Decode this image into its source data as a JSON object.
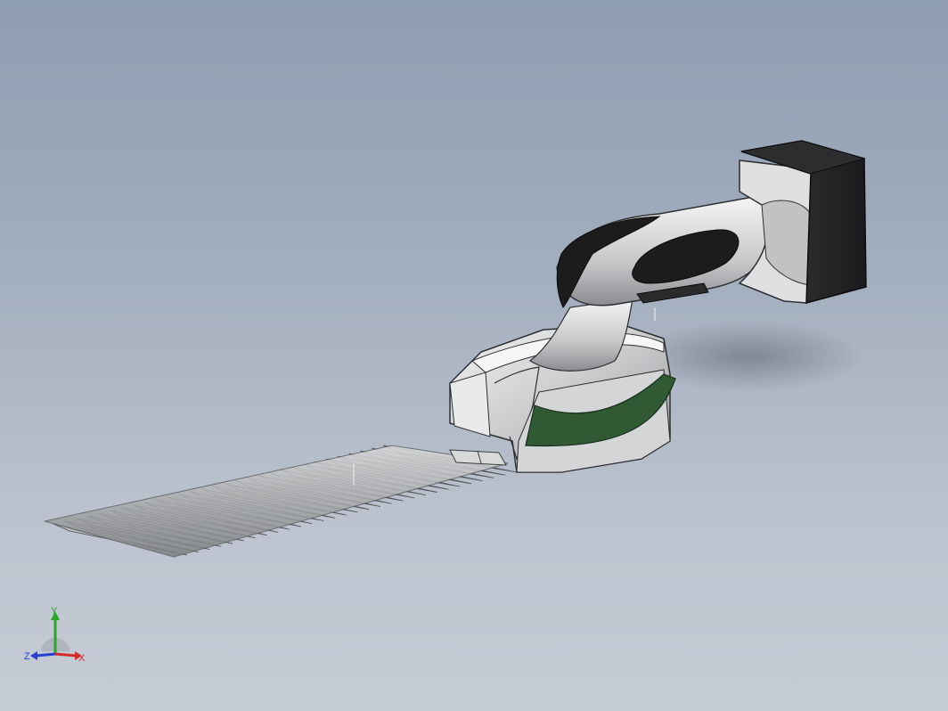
{
  "viewport": {
    "background_top": "#8e9db1",
    "background_bottom": "#c6ccd6"
  },
  "model": {
    "accent_green": "#2f5a33",
    "body_color": "#c9cbcd",
    "battery_color": "#232425",
    "grip_color": "#1c1c1d"
  },
  "triad": {
    "x_label": "X",
    "y_label": "Y",
    "z_label": "Z",
    "x_color": "#d42a2a",
    "y_color": "#2aa52a",
    "z_color": "#2a3ed4"
  }
}
